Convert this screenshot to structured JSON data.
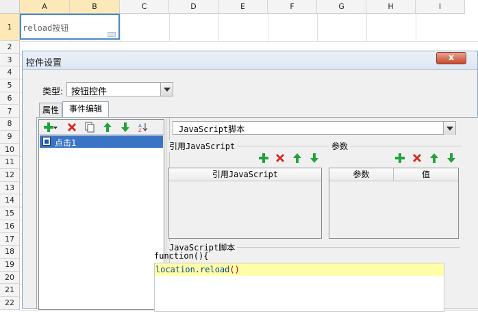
{
  "sheet": {
    "columns": [
      "A",
      "B",
      "C",
      "D",
      "E",
      "F",
      "G",
      "H",
      "I"
    ],
    "rows": [
      "1",
      "2",
      "3",
      "4",
      "5",
      "6",
      "7",
      "8",
      "9",
      "10",
      "11",
      "12",
      "13",
      "14",
      "15",
      "16",
      "17",
      "18",
      "19",
      "20",
      "21",
      "22"
    ],
    "cell_a1_text": "reload按钮"
  },
  "dialog": {
    "title": "控件设置",
    "close_label": "x",
    "type_label": "类型:",
    "type_value": "按钮控件",
    "tabs": [
      "属性",
      "事件编辑"
    ],
    "event_list": [
      "点击1"
    ],
    "script_type": "JavaScript脚本",
    "ref_js_group": "引用JavaScript",
    "ref_js_column": "引用JavaScript",
    "params_group": "参数",
    "params_columns": [
      "参数",
      "值"
    ],
    "script_group": "JavaScript脚本",
    "code_first_line": "function(){",
    "code_body": "location.reload",
    "code_parens": "()"
  }
}
